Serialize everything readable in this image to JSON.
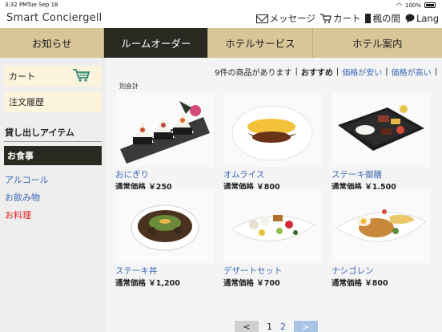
{
  "status": {
    "time": "3:32 PM",
    "date": "Tue Sep 18",
    "battery": "100%"
  },
  "header": {
    "title": "Smart Conciergell",
    "messages": "メッセージ",
    "cart": "カート",
    "room": "楓の間",
    "lang": "Lang"
  },
  "tabs": [
    "お知らせ",
    "ルームオーダー",
    "ホテルサービス",
    "ホテル案内"
  ],
  "sidebar": {
    "cart": "カート",
    "history": "注文履歴",
    "section": "貸し出しアイテム",
    "active": "お食事",
    "links": [
      "アルコール",
      "お飲み物",
      "お料理"
    ]
  },
  "filter": {
    "count": "9件の商品があります",
    "sep1": "|",
    "recommend": "おすすめ",
    "sep2": "|",
    "cheap": "価格が安い",
    "sep3": "|",
    "expensive": "価格が高い",
    "sep4": "|"
  },
  "separate_bill": "別会計",
  "products": [
    {
      "name": "おにぎり",
      "price": "通常価格 ￥250"
    },
    {
      "name": "オムライス",
      "price": "通常価格 ￥800"
    },
    {
      "name": "ステーキ御膳",
      "price": "通常価格 ￥1,500"
    },
    {
      "name": "ステーキ丼",
      "price": "通常価格 ￥1,200"
    },
    {
      "name": "デザートセット",
      "price": "通常価格 ￥700"
    },
    {
      "name": "ナシゴレン",
      "price": "通常価格 ￥800"
    }
  ],
  "pager": {
    "prev": "<",
    "page1": "1",
    "page2": "2",
    "next": ">"
  },
  "colors": {
    "tab_bg": "#d8c598",
    "active_bg": "#2b2a22",
    "link": "#3a66b3",
    "red_link": "#e02020"
  }
}
